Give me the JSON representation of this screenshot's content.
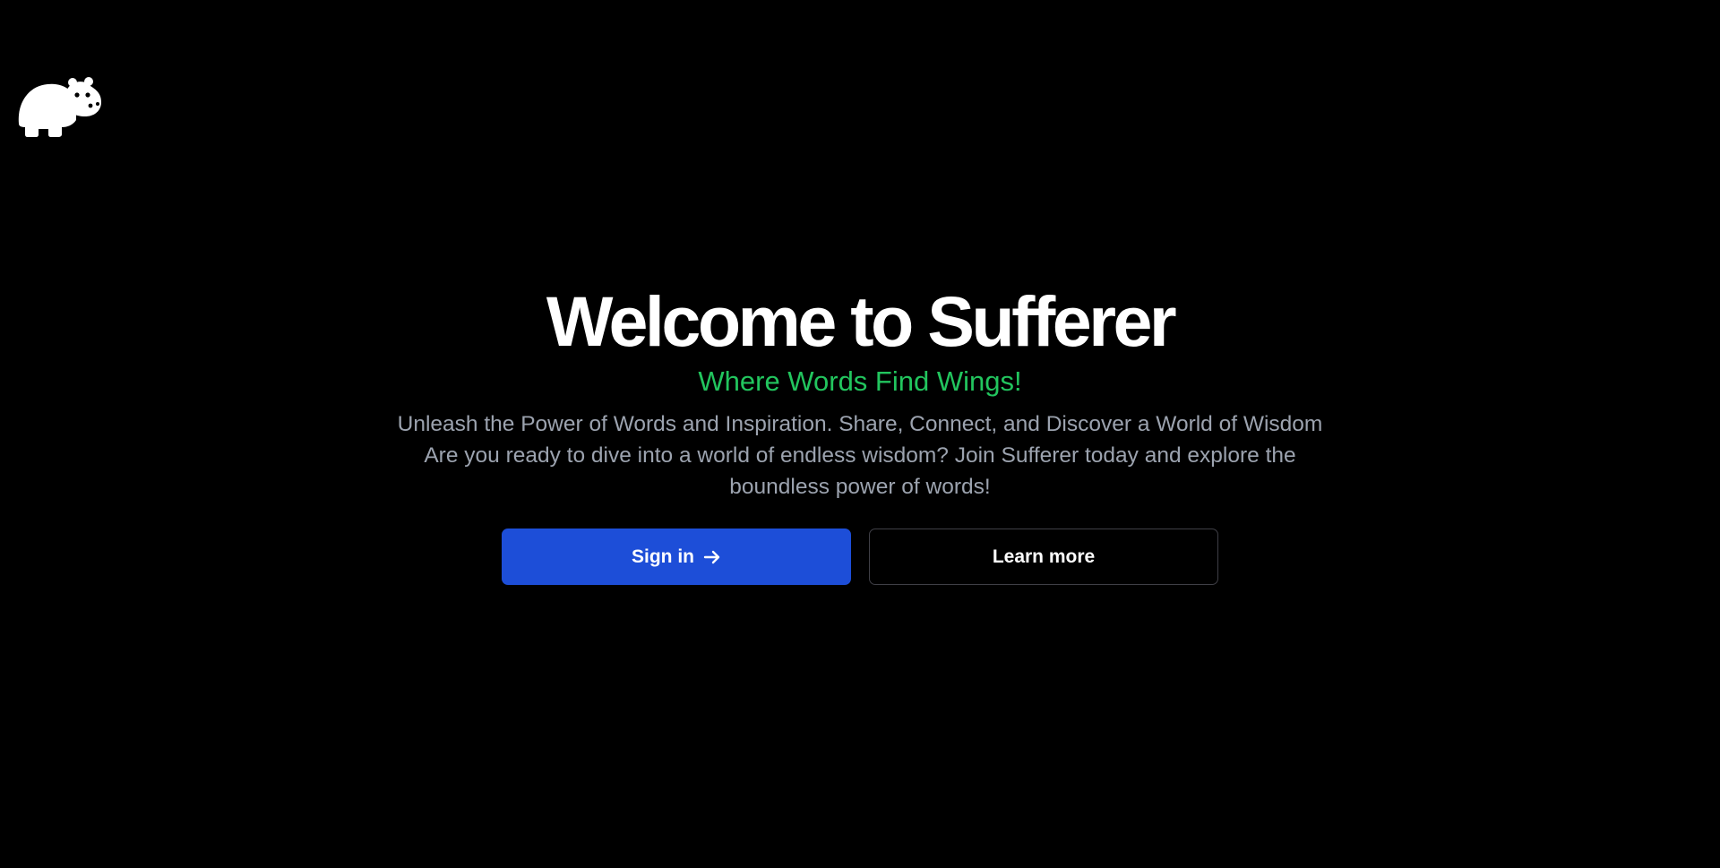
{
  "logo": {
    "icon": "hippo-icon",
    "color": "#ffffff"
  },
  "hero": {
    "title": "Welcome to Sufferer",
    "tagline": "Where Words Find Wings!",
    "description": "Unleash the Power of Words and Inspiration. Share, Connect, and Discover a World of Wisdom Are you ready to dive into a world of endless wisdom? Join Sufferer today and explore the boundless power of words!"
  },
  "actions": {
    "signin_label": "Sign in",
    "signin_icon": "arrow-right-icon",
    "learn_more_label": "Learn more"
  },
  "colors": {
    "background": "#000000",
    "tagline": "#22c55e",
    "primary_button": "#1d4ed8",
    "description_text": "#9ca3af"
  }
}
